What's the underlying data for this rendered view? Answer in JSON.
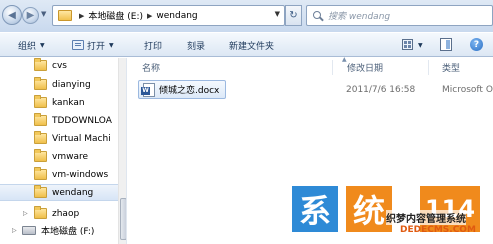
{
  "address": {
    "path": [
      "本地磁盘 (E:)",
      "wendang"
    ],
    "search_placeholder": "搜索 wendang"
  },
  "toolbar": {
    "organize": "组织",
    "open": "打开",
    "print": "打印",
    "burn": "刻录",
    "new_folder": "新建文件夹"
  },
  "nav": {
    "items": [
      {
        "label": "cvs"
      },
      {
        "label": "dianying"
      },
      {
        "label": "kankan"
      },
      {
        "label": "TDDOWNLOA"
      },
      {
        "label": "Virtual Machi"
      },
      {
        "label": "vmware"
      },
      {
        "label": "vm-windows"
      },
      {
        "label": "wendang",
        "selected": true
      },
      {
        "label": "zhaop"
      }
    ],
    "drive": "本地磁盘 (F:)"
  },
  "columns": {
    "name": "名称",
    "date": "修改日期",
    "type": "类型"
  },
  "files": [
    {
      "name": "倾城之恋.docx",
      "date": "2011/7/6 16:58",
      "type": "Microsoft O"
    }
  ],
  "watermark": {
    "char1": "系",
    "char2": "统",
    "num": "114",
    "line1": "织梦内容管理系统",
    "line2": "DEDECMS.COM"
  }
}
